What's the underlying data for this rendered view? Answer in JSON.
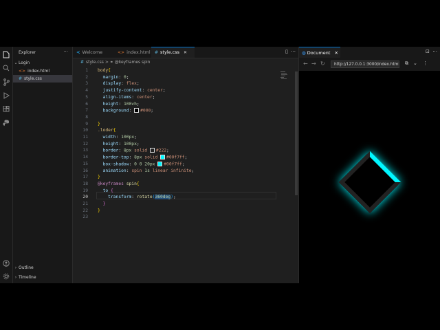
{
  "sidebar": {
    "title": "Explorer",
    "folder": "Login",
    "files": [
      {
        "name": "index.html",
        "type": "html"
      },
      {
        "name": "style.css",
        "type": "css",
        "selected": true
      }
    ],
    "outline": "Outline",
    "timeline": "Timeline"
  },
  "tabs": [
    {
      "label": "Welcome",
      "icon": "vscode-icon"
    },
    {
      "label": "index.html",
      "icon": "html-icon"
    },
    {
      "label": "style.css",
      "icon": "css-icon",
      "active": true
    }
  ],
  "breadcrumb": {
    "file": "style.css",
    "sep": ">",
    "symbol": "@keyframes spin"
  },
  "editor": {
    "current_line": 20,
    "lines": [
      {
        "n": "1",
        "html": "<span class='t-sel'>body</span><span class='t-br'>{</span>"
      },
      {
        "n": "2",
        "html": "  <span class='t-prop'>margin</span>: <span class='t-num'>0</span>;"
      },
      {
        "n": "3",
        "html": "  <span class='t-prop'>display</span>: <span class='t-val'>flex</span>;"
      },
      {
        "n": "4",
        "html": "  <span class='t-prop'>justify-content</span>: <span class='t-val'>center</span>;"
      },
      {
        "n": "5",
        "html": "  <span class='t-prop'>align-items</span>: <span class='t-val'>center</span>;"
      },
      {
        "n": "6",
        "html": "  <span class='t-prop'>height</span>: <span class='t-num'>100vh</span>;"
      },
      {
        "n": "7",
        "html": "  <span class='t-prop'>background</span>: <span class='swatch' style='background:#000'></span><span class='t-val'>#000</span>;"
      },
      {
        "n": "8",
        "html": ""
      },
      {
        "n": "9",
        "html": "<span class='t-br'>}</span>"
      },
      {
        "n": "10",
        "html": "<span class='t-sel'>.loder</span><span class='t-br'>{</span>"
      },
      {
        "n": "11",
        "html": "  <span class='t-prop'>width</span>: <span class='t-num'>100px</span>;"
      },
      {
        "n": "12",
        "html": "  <span class='t-prop'>height</span>: <span class='t-num'>100px</span>;"
      },
      {
        "n": "13",
        "html": "  <span class='t-prop'>border</span>: <span class='t-num'>8px</span> <span class='t-val'>solid</span> <span class='swatch' style='background:#222'></span><span class='t-val'>#222</span>;"
      },
      {
        "n": "14",
        "html": "  <span class='t-prop'>border-top</span>: <span class='t-num'>8px</span> <span class='t-val'>solid</span> <span class='swatch' style='background:#00f7ff'></span><span class='t-val'>#00f7ff</span>;"
      },
      {
        "n": "15",
        "html": "  <span class='t-prop'>box-shadow</span>: <span class='t-num'>0</span> <span class='t-num'>0</span> <span class='t-num'>20px</span> <span class='swatch' style='background:#00f7ff'></span><span class='t-val'>#00f7ff</span>;"
      },
      {
        "n": "16",
        "html": "  <span class='t-prop'>animation</span>: <span class='t-val'>spin</span> <span class='t-num'>1s</span> <span class='t-val'>linear</span> <span class='t-val'>infinite</span>;"
      },
      {
        "n": "17",
        "html": "<span class='t-br'>}</span>"
      },
      {
        "n": "18",
        "html": "<span class='t-at'>@keyframes</span> <span class='t-name'>spin</span><span class='t-br'>{</span>"
      },
      {
        "n": "19",
        "html": "  <span class='t-prop'>to</span> <span class='t-br2'>{</span>"
      },
      {
        "n": "20",
        "html": "    <span class='t-prop'>transform</span>: <span class='t-name'>rotate</span><span class='t-br3'>(</span><span class='t-num hl'>360deg</span><span class='t-br3'>)</span>;"
      },
      {
        "n": "21",
        "html": "  <span class='t-br2'>}</span>"
      },
      {
        "n": "22",
        "html": "<span class='t-br'>}</span>"
      },
      {
        "n": "23",
        "html": ""
      }
    ]
  },
  "browser": {
    "tab_label": "Document",
    "url": "http://127.0.0.1:3000/index.html...",
    "loader_colors": {
      "border": "#222222",
      "accent": "#00f7ff"
    }
  }
}
